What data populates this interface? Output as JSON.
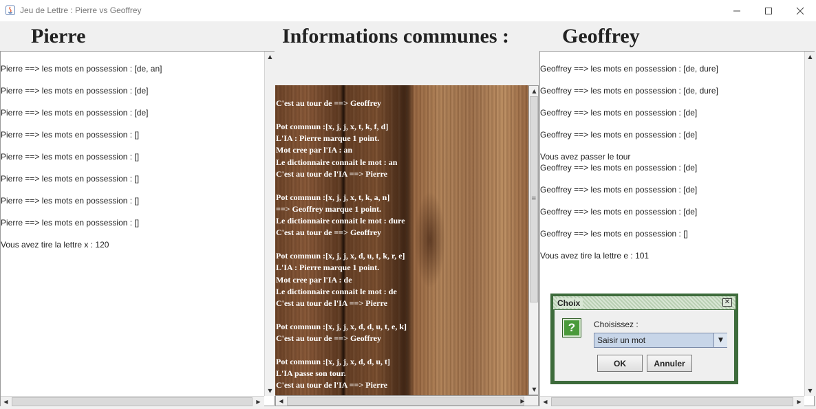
{
  "window": {
    "title": "Jeu de Lettre : Pierre vs Geoffrey",
    "minimize": "─",
    "maximize": "☐",
    "close": "✕"
  },
  "headers": {
    "left": "Pierre",
    "center": "Informations communes :",
    "right": "Geoffrey"
  },
  "left_panel": {
    "lines": [
      "Pierre ==> les mots en possession  : [de, an]",
      "Pierre ==> les mots en possession  : [de]",
      "Pierre ==> les mots en possession  : [de]",
      "Pierre ==> les mots en possession  : []",
      "Pierre ==> les mots en possession  : []",
      "Pierre ==> les mots en possession  : []",
      "Pierre ==> les mots en possession  : []",
      "Pierre ==> les mots en possession  : []",
      "Vous avez tire la lettre x : 120"
    ]
  },
  "center_panel": {
    "lines": [
      "C'est au tour de ==> Geoffrey",
      "",
      "Pot commun :[x, j, j, x, t, k, f, d]",
      "L'IA : Pierre marque 1 point.",
      "Mot cree par l'IA : an",
      "Le dictionnaire connait le mot : an",
      "C'est au tour de l'IA ==> Pierre",
      "",
      "Pot commun :[x, j, j, x, t, k, a, n]",
      "==> Geoffrey marque 1 point.",
      "Le dictionnaire connait le mot : dure",
      "C'est au tour de ==> Geoffrey",
      "",
      "Pot commun :[x, j, j, x, d, u, t, k, r, e]",
      "L'IA : Pierre marque 1 point.",
      "Mot cree par l'IA : de",
      "Le dictionnaire connait le mot : de",
      "C'est au tour de l'IA ==> Pierre",
      "",
      "Pot commun :[x, j, j, x, d, d, u, t, e, k]",
      "C'est au tour de ==> Geoffrey",
      "",
      "Pot commun :[x, j, j, x, d, d, u, t]",
      "L'IA passe son tour.",
      "C'est au tour de l'IA ==> Pierre"
    ]
  },
  "right_panel": {
    "lines": [
      "Geoffrey ==> les mots en possession  : [de, dure]",
      "Geoffrey ==> les mots en possession  : [de, dure]",
      "Geoffrey ==> les mots en possession  : [de]",
      "Geoffrey ==> les mots en possession  : [de]",
      "Vous avez passer le tour",
      "Geoffrey ==> les mots en possession  : [de]",
      "Geoffrey ==> les mots en possession  : [de]",
      "Geoffrey ==> les mots en possession  : [de]",
      "Geoffrey ==> les mots en possession  : []",
      "Vous avez tire la lettre e : 101"
    ]
  },
  "dialog": {
    "title": "Choix",
    "close": "✕",
    "icon": "?",
    "label": "Choisissez :",
    "selected": "Saisir un mot",
    "ok": "OK",
    "cancel": "Annuler"
  },
  "scroll": {
    "up": "▲",
    "down": "▼",
    "left": "◀",
    "right": "▶",
    "grip": "≡"
  }
}
